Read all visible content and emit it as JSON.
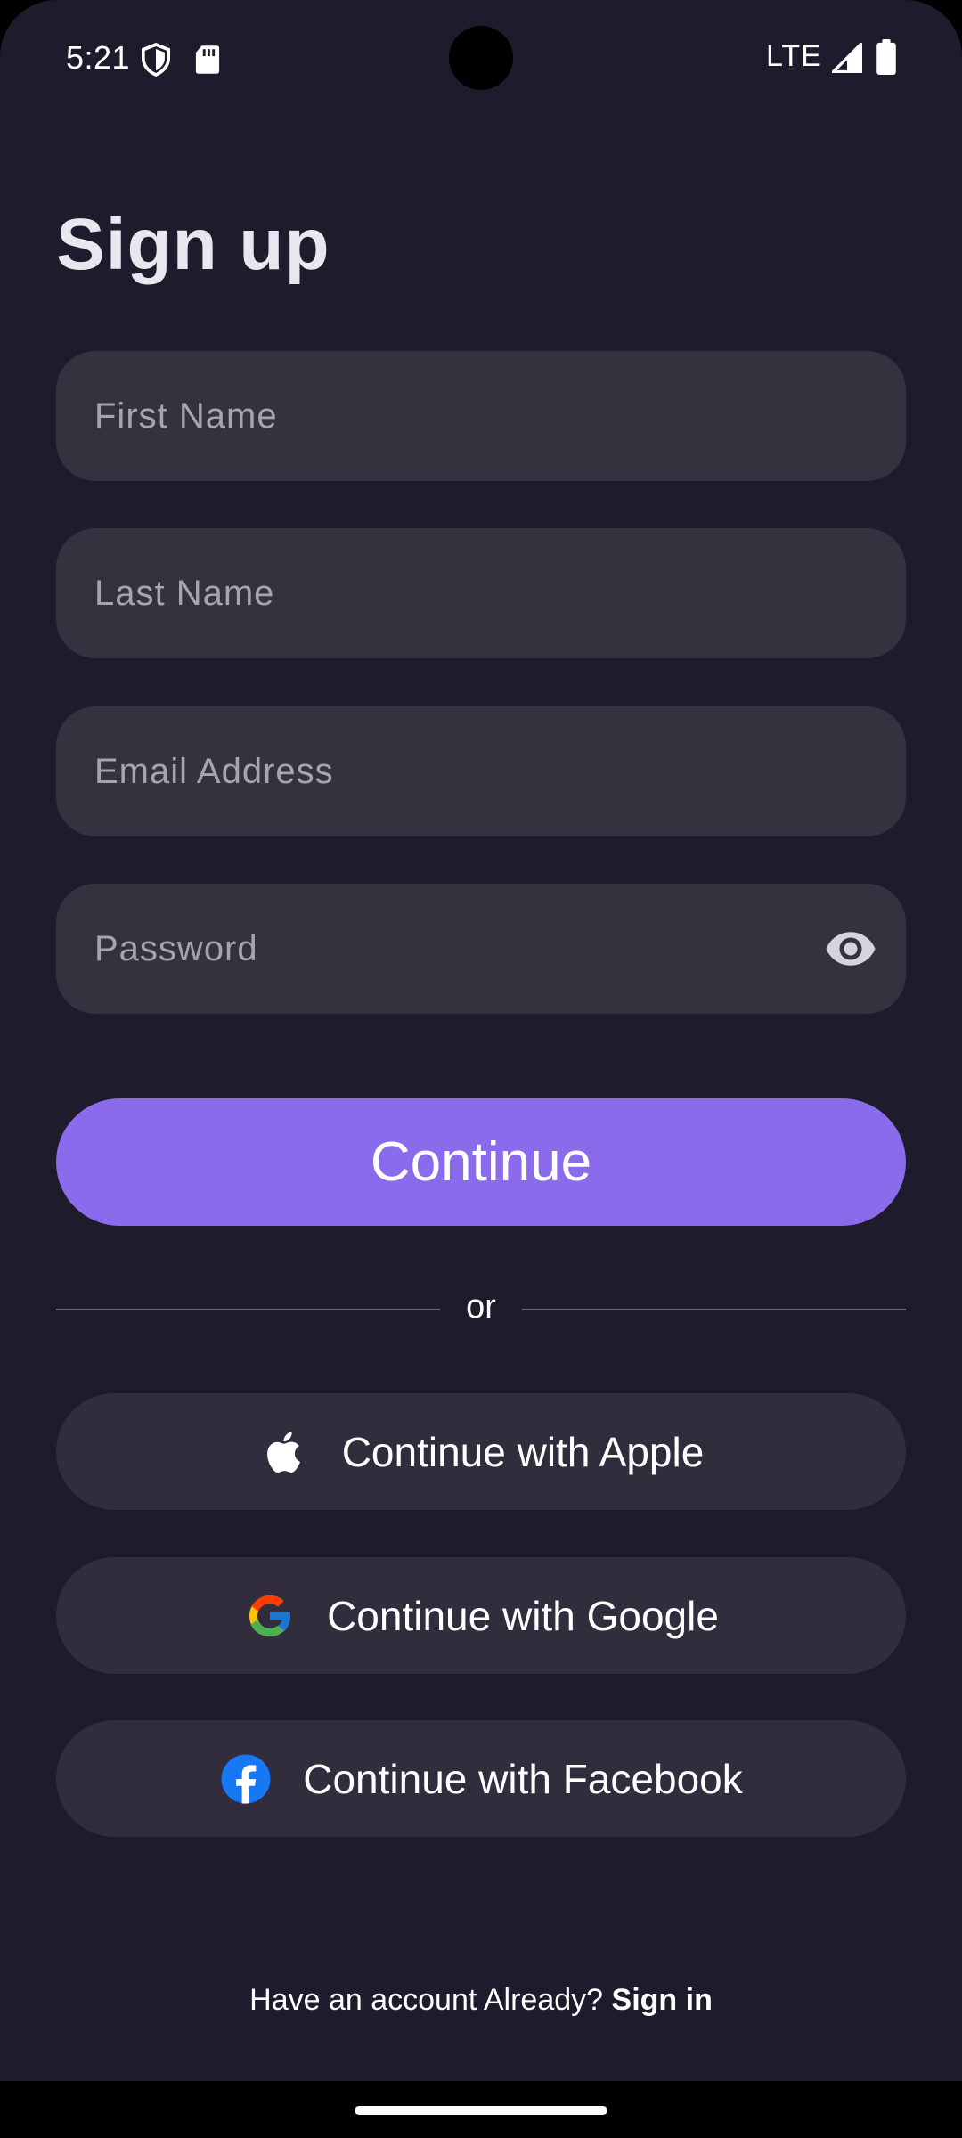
{
  "status_bar": {
    "time": "5:21",
    "network": "LTE"
  },
  "page": {
    "title": "Sign up"
  },
  "form": {
    "first_name_placeholder": "First Name",
    "first_name_value": "",
    "last_name_placeholder": "Last Name",
    "last_name_value": "",
    "email_placeholder": "Email Address",
    "email_value": "",
    "password_placeholder": "Password",
    "password_value": ""
  },
  "actions": {
    "continue_label": "Continue",
    "divider_text": "or",
    "apple_label": "Continue with Apple",
    "google_label": "Continue with Google",
    "facebook_label": "Continue with Facebook"
  },
  "footer": {
    "prompt": "Have an account Already?",
    "signin_label": "Sign in"
  },
  "icons": {
    "password_toggle": "eye-icon",
    "apple": "apple-logo-icon",
    "google": "google-logo-icon",
    "facebook": "facebook-logo-icon"
  },
  "colors": {
    "background": "#1e1b2c",
    "field": "#35313f",
    "primary": "#8a6bec",
    "social_button": "#312d3d",
    "placeholder": "#a7a3b0",
    "facebook_blue": "#1877f2"
  }
}
